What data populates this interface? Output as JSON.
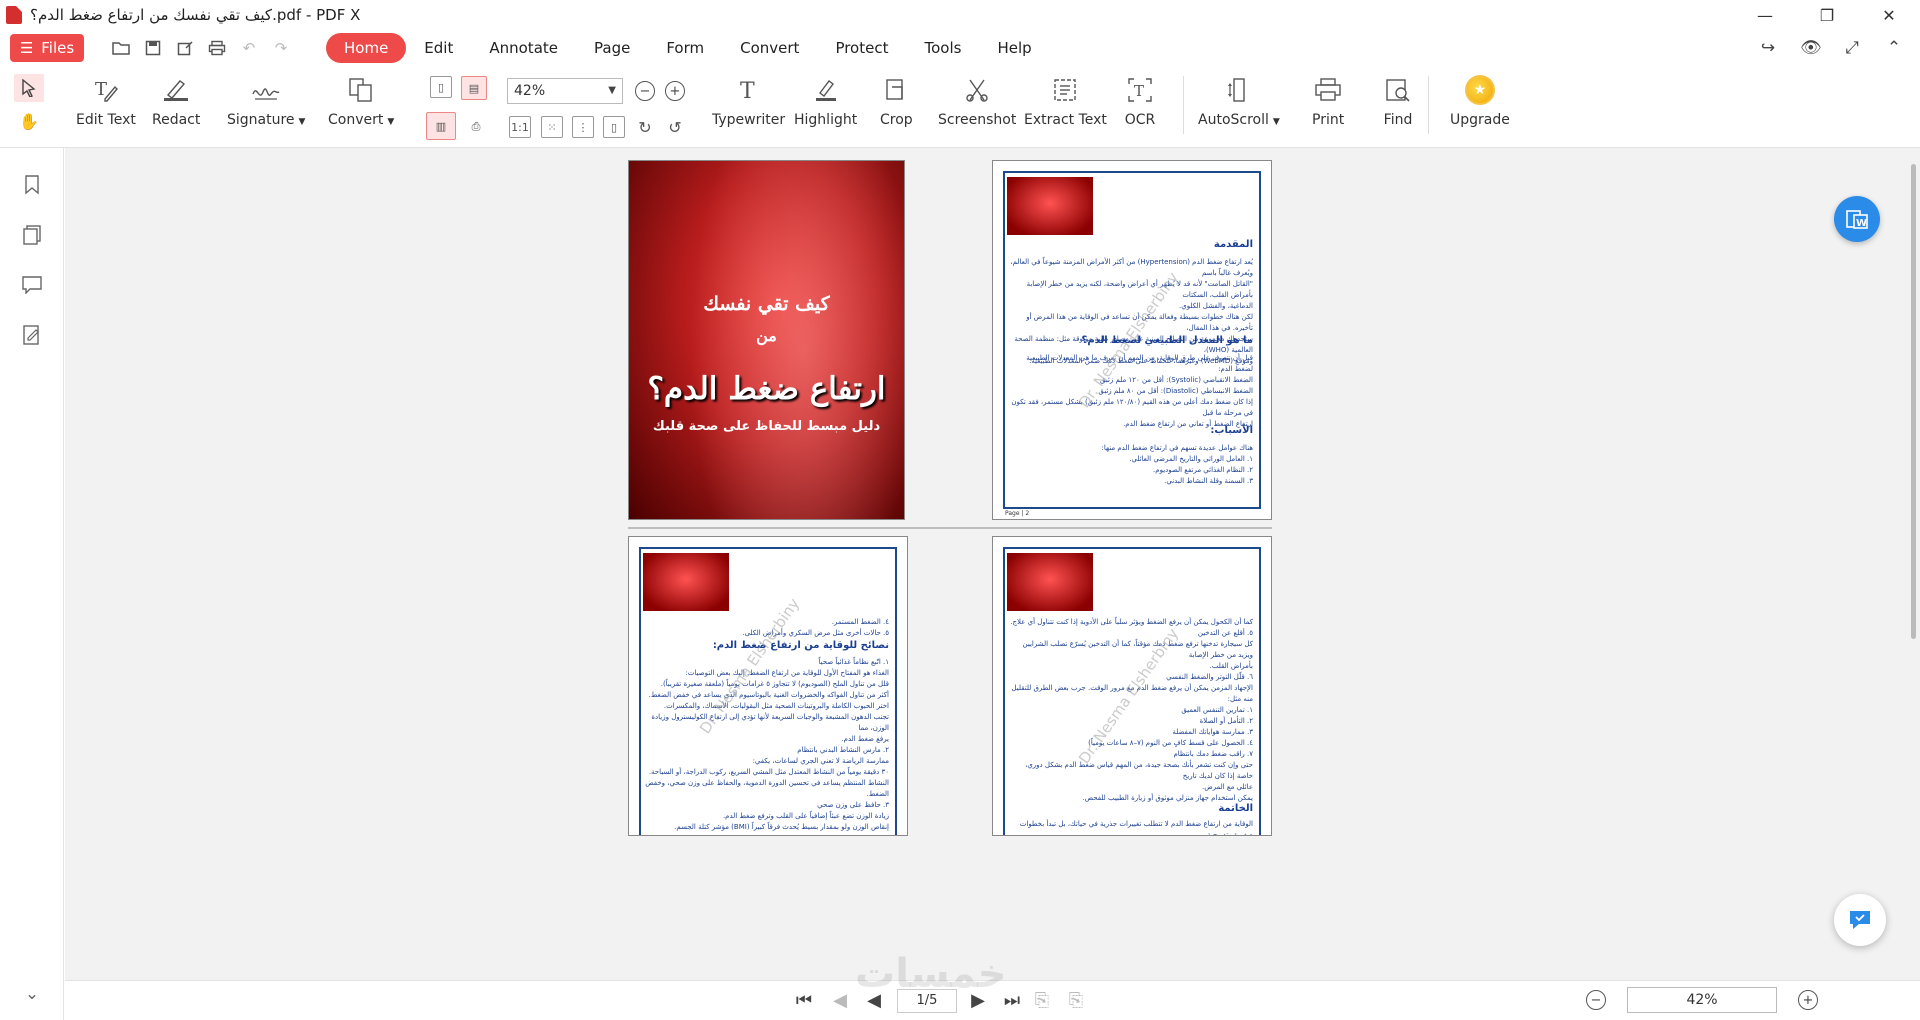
{
  "window": {
    "title": "كيف تقي نفسك من ارتفاع ضغط الدم؟.pdf - PDF X",
    "minimize": "—",
    "maximize": "❐",
    "close": "✕"
  },
  "menubar": {
    "files_label": "Files",
    "tabs": [
      {
        "label": "Home",
        "active": true
      },
      {
        "label": "Edit"
      },
      {
        "label": "Annotate"
      },
      {
        "label": "Page"
      },
      {
        "label": "Form"
      },
      {
        "label": "Convert"
      },
      {
        "label": "Protect"
      },
      {
        "label": "Tools"
      },
      {
        "label": "Help"
      }
    ],
    "accent_color": "#ef4a4a"
  },
  "toolbar": {
    "zoom_value": "42%",
    "tools": [
      {
        "label": "Edit Text",
        "icon": "edit-text-icon"
      },
      {
        "label": "Redact",
        "icon": "redact-icon"
      },
      {
        "label": "Signature",
        "icon": "signature-icon"
      },
      {
        "label": "Convert",
        "icon": "convert-icon"
      },
      {
        "label": "Typewriter",
        "icon": "typewriter-icon"
      },
      {
        "label": "Highlight",
        "icon": "highlight-icon"
      },
      {
        "label": "Crop",
        "icon": "crop-icon"
      },
      {
        "label": "Screenshot",
        "icon": "screenshot-icon"
      },
      {
        "label": "Extract Text",
        "icon": "extract-text-icon"
      },
      {
        "label": "OCR",
        "icon": "ocr-icon"
      },
      {
        "label": "AutoScroll",
        "icon": "autoscroll-icon"
      },
      {
        "label": "Print",
        "icon": "print-icon"
      },
      {
        "label": "Find",
        "icon": "find-icon"
      },
      {
        "label": "Upgrade",
        "icon": "upgrade-icon"
      }
    ]
  },
  "document": {
    "cover": {
      "line1": "كيف تقي نفسك",
      "line2": "من",
      "title": "ارتفاع ضغط الدم؟",
      "subtitle": "دليل مبسط للحفاظ على صحة قلبك"
    },
    "page2": {
      "h_intro": "المقدمة",
      "intro": "يُعد ارتفاع ضغط الدم (Hypertension) من أكثر الأمراض المزمنة شيوعاً في العالم، ويُعرف غالباً باسم\n\"القاتل الصامت\" لأنه قد لا يُظهر أي أعراض واضحة، لكنه يزيد من خطر الإصابة بأمراض القلب، السكتات\nالدماغية، والفشل الكلوي.\nلكن هناك خطوات بسيطة وفعالة يمكن أن تساعد في الوقاية من هذا المرض أو تأخيره. في هذا المقال،\nستجد لك مجموعة من النصائح المبنية على مصادر طبية موثوقة مثل: منظمة الصحة العالمية (WHO)،\nوموقع (WebMD) وغيرهما، للحفاظ على ضغط دمك ضمن المعدلات الطبيعية.",
      "h_normal": "ما هو المعدل الطبيعي لضغط الدم؟",
      "normal": "قبل أن نتعرف على طرق الوقاية، من المهم أن نعرف ما هي المعدلات الطبيعية لضغط الدم:\nالضغط الانقباضي (Systolic): أقل من ١٢٠ ملم زئبق\nالضغط الانبساطي (Diastolic): أقل من ٨٠ ملم زئبق\nإذا كان ضغط دمك أعلى من هذه القيم (١٢٠/٨٠ ملم زئبق) بشكل مستمر، فقد تكون في مرحلة ما قبل\nارتفاع الضغط أو تعاني من ارتفاع ضغط الدم.",
      "h_causes": "الأسباب:",
      "causes": "هناك عوامل عديدة تسهم في ارتفاع ضغط الدم منها:\n١. العامل الوراثي والتاريخ المرضي العائلي.\n٢. النظام الغذائي مرتفع الصوديوم.\n٣. السمنة وقلة النشاط البدني.",
      "footer": "Page | 2"
    },
    "page3": {
      "top": "٤. الضغط المستمر.\n٥. حالات أخرى مثل مرض السكري وأمراض الكلى.",
      "h_tips": "نصائح للوقاية من ارتفاع ضغط الدم:",
      "body": "١. اتّبع نظاماً غذائياً صحياً\nالغذاء هو المفتاح الأول للوقاية من ارتفاع الضغط. إليك بعض التوصيات:\nقلل من تناول الملح (الصوديوم) لا تتجاوز ٥ غرامات يومياً (ملعقة صغيرة تقريباً).\nأكثر من تناول الفواكه والخضروات الغنية بالبوتاسيوم الذي يساعد في خفض الضغط.\nاختر الحبوب الكاملة والبروتينات الصحية مثل البقوليات، الأسماك، والمكسرات.\nتجنب الدهون المشبعة والوجبات السريعة لأنها تؤدي إلى ارتفاع الكوليسترول وزيادة الوزن، مما\nيرفع ضغط الدم.\n٢. مارس النشاط البدني بانتظام\nممارسة الرياضة لا تعني الجري لساعات، يكفي:\n٣٠ دقيقة يومياً من النشاط المعتدل مثل المشي السريع، ركوب الدراجة، أو السباحة.\nالنشاط المنتظم يساعد في تحسين الدورة الدموية، والحفاظ على وزن صحي، وخفض الضغط.\n٣. حافظ على وزن صحي\nزيادة الوزن تضع عبئاً إضافياً على القلب وترفع ضغط الدم.\nإنقاص الوزن ولو بمقدار بسيط يُحدث فرقاً كبيراً (BMI) مؤشر كتلة الجسم."
    },
    "page4": {
      "body": "كما أن الكحول يمكن أن يرفع الضغط ويؤثر سلباً على الأدوية إذا كنت تتناول أي علاج.\n٥. أقلع عن التدخين\nكل سيجارة تدخنها ترفع ضغط دمك مؤقتاً، كما أن التدخين يُسرّع تصلب الشرايين ويزيد من خطر الإصابة\nبأمراض القلب.\n٦. قلّل التوتر والضغط النفسي\nالإجهاد المزمن يمكن أن يرفع ضغط الدم مع مرور الوقت. جرب بعض الطرق للتقليل منه مثل:\n١. تمارين التنفس العميق\n٢. التأمل أو الصلاة\n٣. ممارسة هواياتك المفضلة\n٤. الحصول على قسط كافٍ من النوم (٧–٨ ساعات يومياً)\n٧. راقب ضغط دمك بانتظام\nحتى وإن كنت تشعر بأنك بصحة جيدة، من المهم قياس ضغط الدم بشكل دوري، خاصة إذا كان لديك تاريخ\nعائلي مع المرض.\nيمكن استخدام جهاز منزلي موثوق أو زيارة الطبيب للفحص.",
      "h_conclusion": "الخاتمة",
      "conclusion": "الوقاية من ارتفاع ضغط الدم لا تتطلب تغييرات جذرية في حياتك، بل تبدأ بخطوات صغيرة وتدريجية."
    },
    "watermark": "Dr. Nesma Elsherbiny"
  },
  "bottombar": {
    "page_indicator": "1/5",
    "zoom_value": "42%",
    "site_watermark": "خمسات"
  }
}
